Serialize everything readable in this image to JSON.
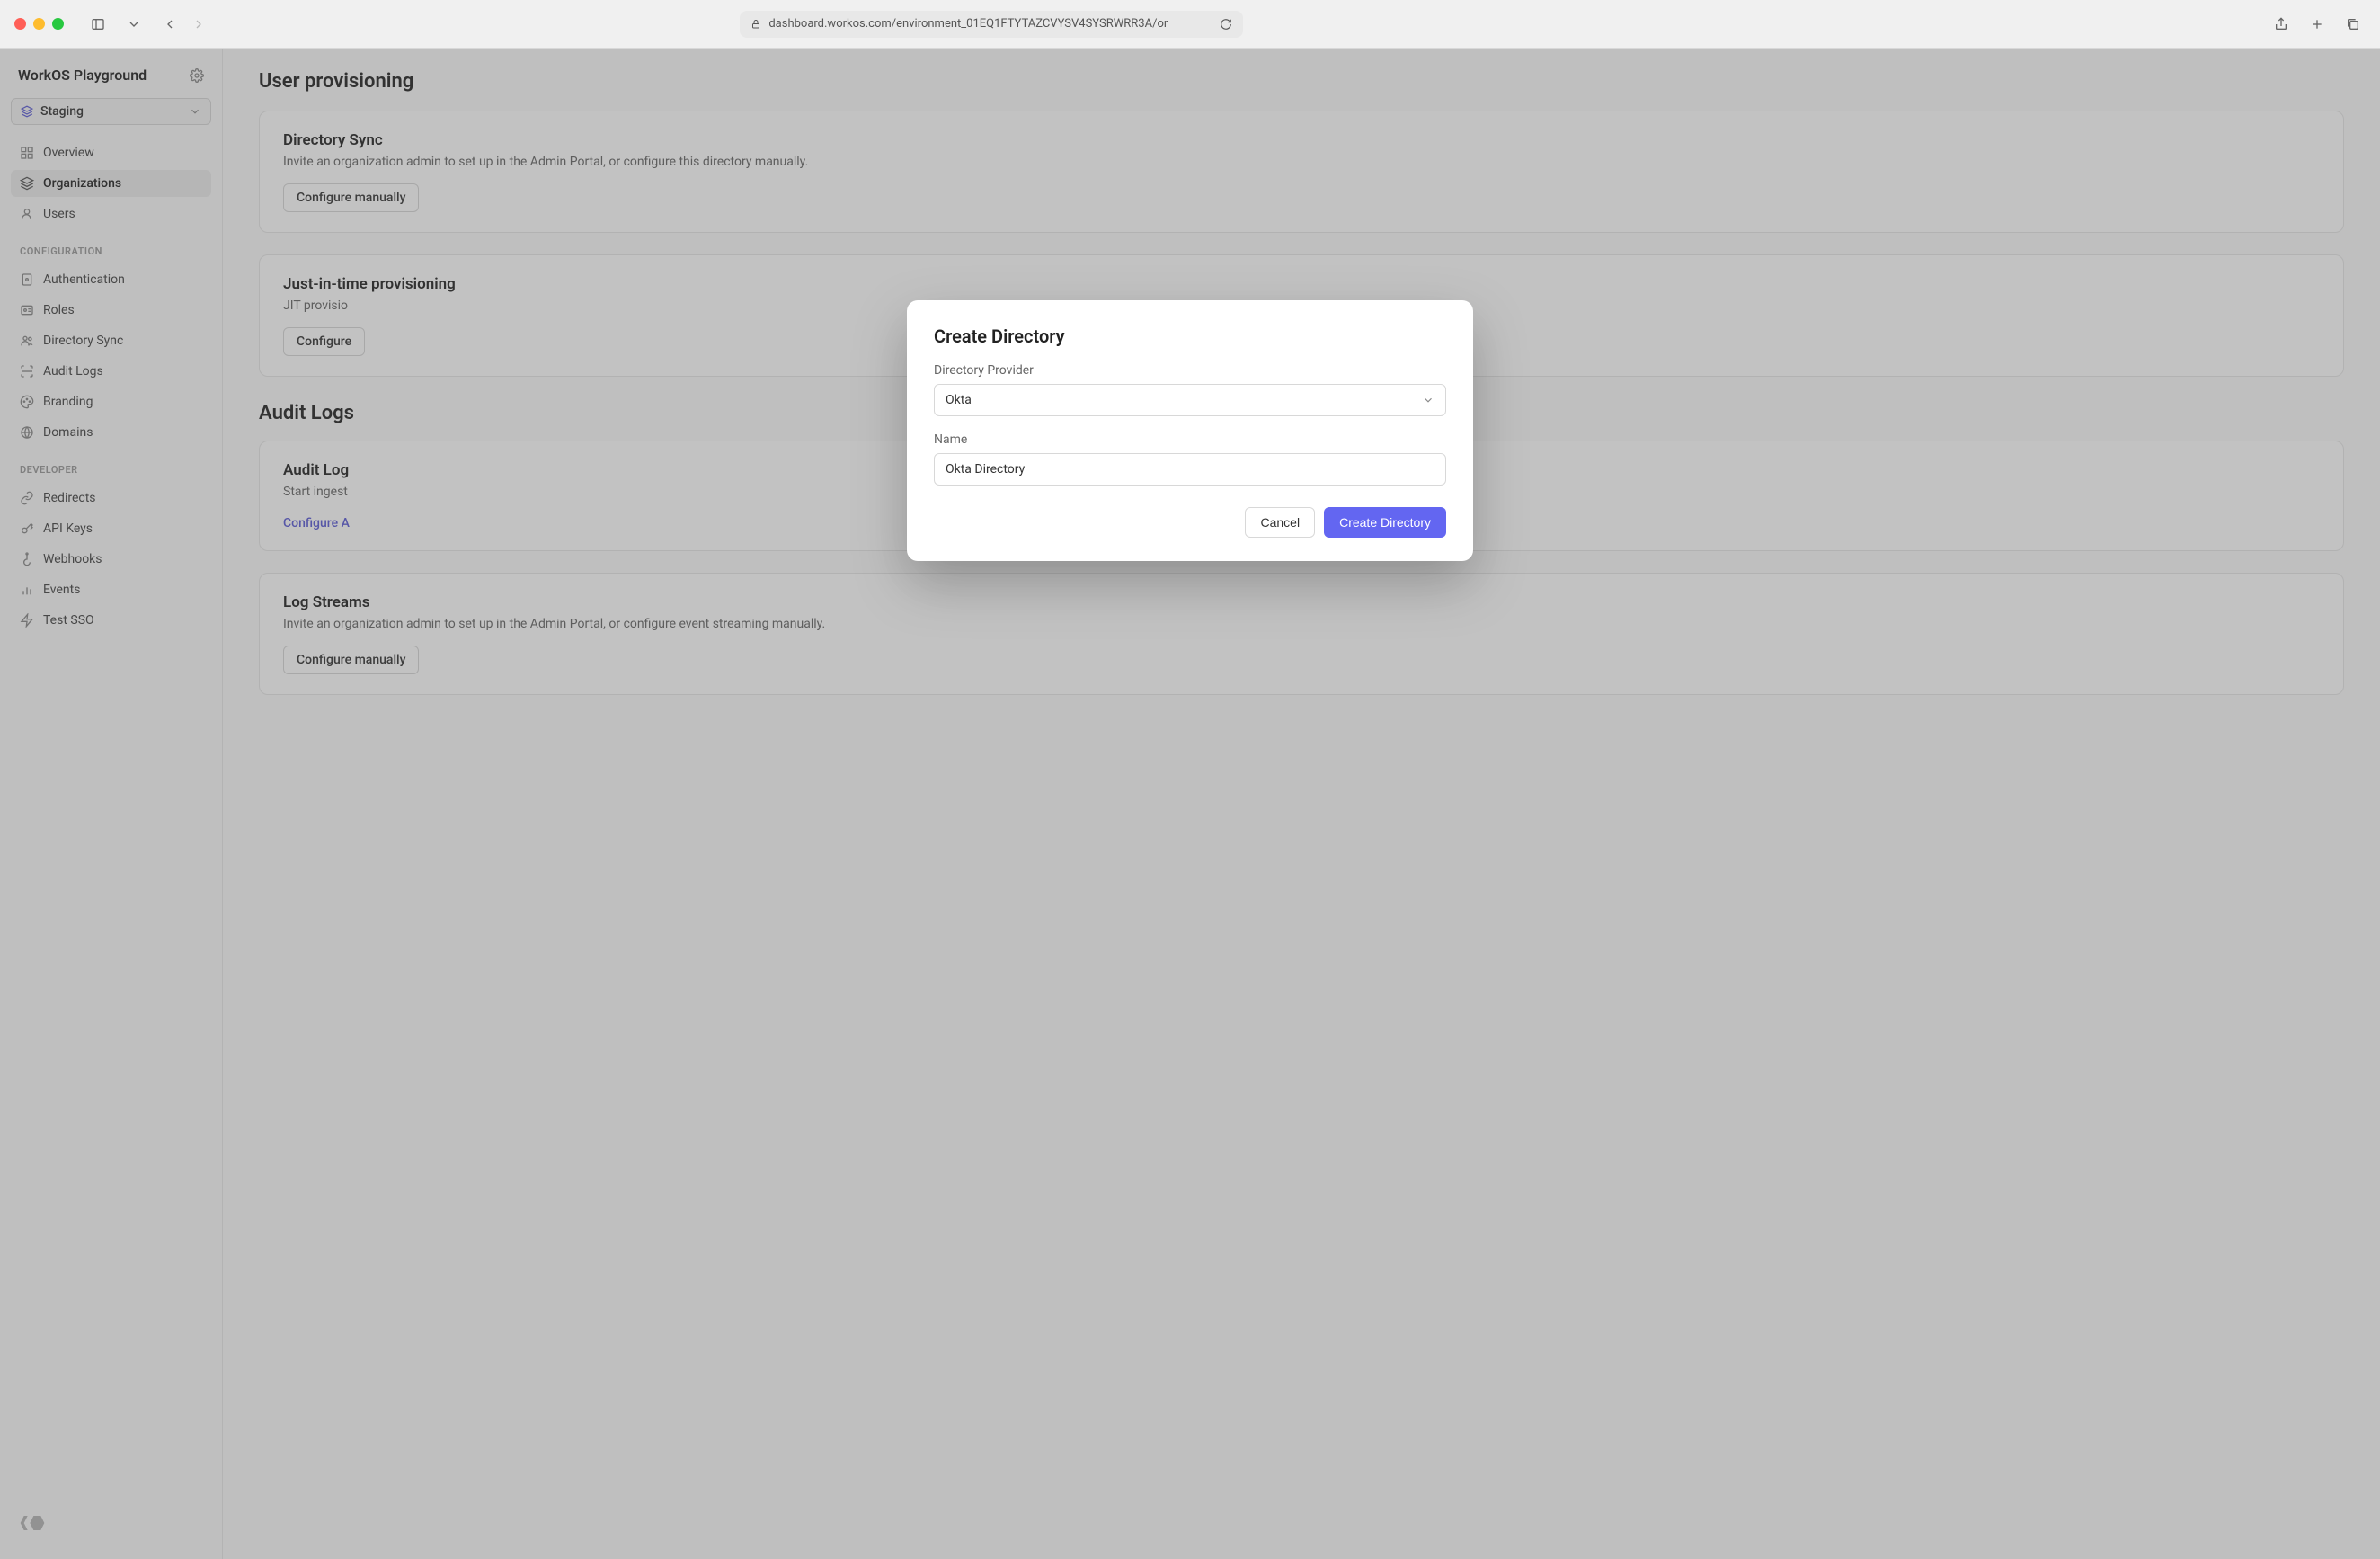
{
  "browser": {
    "url": "dashboard.workos.com/environment_01EQ1FTYTAZCVYSV4SYSRWRR3A/or"
  },
  "sidebar": {
    "workspace": "WorkOS Playground",
    "environment": "Staging",
    "nav_main": [
      {
        "label": "Overview",
        "icon": "grid"
      },
      {
        "label": "Organizations",
        "icon": "layers",
        "active": true
      },
      {
        "label": "Users",
        "icon": "user"
      }
    ],
    "section_config_label": "CONFIGURATION",
    "nav_config": [
      {
        "label": "Authentication",
        "icon": "key-square"
      },
      {
        "label": "Roles",
        "icon": "id"
      },
      {
        "label": "Directory Sync",
        "icon": "people"
      },
      {
        "label": "Audit Logs",
        "icon": "scan"
      },
      {
        "label": "Branding",
        "icon": "palette"
      },
      {
        "label": "Domains",
        "icon": "globe"
      }
    ],
    "section_dev_label": "DEVELOPER",
    "nav_dev": [
      {
        "label": "Redirects",
        "icon": "link"
      },
      {
        "label": "API Keys",
        "icon": "key"
      },
      {
        "label": "Webhooks",
        "icon": "hook"
      },
      {
        "label": "Events",
        "icon": "bars"
      },
      {
        "label": "Test SSO",
        "icon": "bolt"
      }
    ]
  },
  "main": {
    "heading1": "User provisioning",
    "cards1": [
      {
        "title": "Directory Sync",
        "desc": "Invite an organization admin to set up in the Admin Portal, or configure this directory manually.",
        "button": "Configure manually"
      },
      {
        "title": "Just-in-time provisioning",
        "desc": "JIT provisio",
        "button": "Configure"
      }
    ],
    "heading2": "Audit Logs",
    "cards2": [
      {
        "title": "Audit Log",
        "desc": "Start ingest",
        "link": "Configure A"
      },
      {
        "title": "Log Streams",
        "desc": "Invite an organization admin to set up in the Admin Portal, or configure event streaming manually.",
        "button": "Configure manually"
      }
    ]
  },
  "modal": {
    "title": "Create Directory",
    "provider_label": "Directory Provider",
    "provider_value": "Okta",
    "name_label": "Name",
    "name_value": "Okta Directory",
    "cancel": "Cancel",
    "submit": "Create Directory"
  }
}
